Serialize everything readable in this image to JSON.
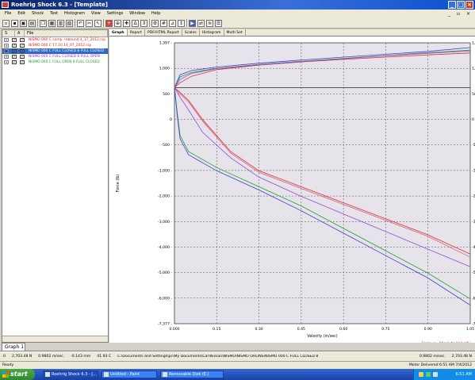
{
  "window": {
    "title": "Roehrig Shock 6.3 - [Template]"
  },
  "menu": [
    "File",
    "Edit",
    "Shock",
    "Test",
    "Histogram",
    "View",
    "Settings",
    "Window",
    "Help"
  ],
  "files": {
    "headers": [
      "S",
      "A",
      "File"
    ],
    "rows": [
      {
        "name": "NISMO 000 C comp. rebound 4_17_2012.rsp",
        "color": "#e02020"
      },
      {
        "name": "NISMO 000 C 17.10 14_07_2012.rsp",
        "color": "#e02020"
      },
      {
        "name": "NISMO 000 C FULL CLOSED 8 FULL CLOSED",
        "color": "#ffffff",
        "selected": true
      },
      {
        "name": "NISMO 000 C FULL CLOSED 8 FULL OPEN",
        "color": "#9030c0"
      },
      {
        "name": "NISMO 000 C FULL OPEN 8 FULL CLOSED",
        "color": "#20a020"
      }
    ]
  },
  "tabs": [
    "Graph",
    "Report",
    "PDF/HTML Report",
    "Scales",
    "Histogram",
    "Multi Set"
  ],
  "chart_data": {
    "type": "line",
    "xlabel": "Velocity (in/sec)",
    "ylabel": "Force (lb)",
    "xlim": [
      0,
      1.05
    ],
    "ylim": [
      -7377,
      1397
    ],
    "x_ticks": [
      "0.000",
      "0.15",
      "0.30",
      "0.45",
      "0.60",
      "0.75",
      "0.90",
      "1.05"
    ],
    "y_ticks": [
      "1,397 -",
      "1,000 -",
      "500 -",
      "0",
      "-500 -",
      "-1,000 -",
      "-2,000 -",
      "-3,000 -",
      "-4,000 -",
      "-5,000 -",
      "-6,000 -",
      "-7,377 -"
    ],
    "footnote": "Force vs. Absolute Velocity",
    "series": [
      {
        "color": "#e03030",
        "x": [
          0,
          0.02,
          0.06,
          0.15,
          0.3,
          0.45,
          0.6,
          0.75,
          0.9,
          1.05
        ],
        "y": [
          0,
          150,
          350,
          560,
          700,
          800,
          880,
          950,
          1020,
          1080
        ]
      },
      {
        "color": "#4040d0",
        "x": [
          0,
          0.02,
          0.06,
          0.15,
          0.3,
          0.45,
          0.6,
          0.75,
          0.9,
          1.05
        ],
        "y": [
          0,
          400,
          530,
          640,
          760,
          860,
          950,
          1040,
          1130,
          1250
        ]
      },
      {
        "color": "#20a030",
        "x": [
          0,
          0.02,
          0.06,
          0.15,
          0.3,
          0.45,
          0.6,
          0.75,
          0.9,
          1.05
        ],
        "y": [
          0,
          330,
          470,
          600,
          720,
          820,
          910,
          1000,
          1090,
          1170
        ]
      },
      {
        "color": "#9050d0",
        "x": [
          0,
          0.02,
          0.06,
          0.15,
          0.3,
          0.45,
          0.6,
          0.75,
          0.9,
          1.05
        ],
        "y": [
          0,
          250,
          440,
          590,
          710,
          810,
          900,
          990,
          1070,
          1140
        ]
      },
      {
        "color": "#e03030",
        "x": [
          0,
          0.02,
          0.05,
          0.1,
          0.2,
          0.3,
          0.45,
          0.6,
          0.75,
          0.9,
          1.05
        ],
        "y": [
          0,
          -150,
          -400,
          -1000,
          -2000,
          -2600,
          -3100,
          -3600,
          -4100,
          -4600,
          -5200
        ]
      },
      {
        "color": "#d06080",
        "x": [
          0,
          0.02,
          0.05,
          0.1,
          0.2,
          0.3,
          0.45,
          0.6,
          0.75,
          0.9,
          1.05
        ],
        "y": [
          0,
          -200,
          -450,
          -1050,
          -2050,
          -2650,
          -3150,
          -3650,
          -4150,
          -4650,
          -5300
        ]
      },
      {
        "color": "#9050d0",
        "x": [
          0,
          0.02,
          0.05,
          0.1,
          0.2,
          0.3,
          0.45,
          0.6,
          0.75,
          0.9,
          1.05
        ],
        "y": [
          0,
          -300,
          -700,
          -1400,
          -2200,
          -2800,
          -3400,
          -3950,
          -4500,
          -5050,
          -5600
        ]
      },
      {
        "color": "#20a030",
        "x": [
          0,
          0.01,
          0.02,
          0.05,
          0.15,
          0.3,
          0.45,
          0.6,
          0.75,
          0.9,
          1.05
        ],
        "y": [
          0,
          -800,
          -1500,
          -2000,
          -2500,
          -3100,
          -3700,
          -4400,
          -5100,
          -5800,
          -6600
        ]
      },
      {
        "color": "#4040d0",
        "x": [
          0,
          0.01,
          0.02,
          0.05,
          0.15,
          0.3,
          0.45,
          0.6,
          0.75,
          0.9,
          1.05
        ],
        "y": [
          0,
          -900,
          -1600,
          -2100,
          -2600,
          -3200,
          -3850,
          -4550,
          -5250,
          -5950,
          -6800
        ]
      }
    ]
  },
  "graph_tab": "Graph 1",
  "status": {
    "items": [
      "0",
      "2,703.48 N",
      "0.9802 m/sec.",
      "-0.143 mm",
      "41.93 C",
      "C:\\Documents and Settings\\pc\\My Documents\\Car\\Nissan\\NISMO\\NISMO OHLINS\\NISMO 000 C FULL CLOSED 8",
      "0.9802 m/sec.",
      "2,703.48 N"
    ],
    "ready": "Ready",
    "right": "Motor   Delivered   6:51 AM   7/4/2012"
  },
  "taskbar": {
    "start": "start",
    "tasks": [
      "Roehrig Shock 6.3 - [...",
      "Untitled - Paint",
      "Removable Disk (E:)"
    ],
    "clock": "6:51 AM"
  }
}
